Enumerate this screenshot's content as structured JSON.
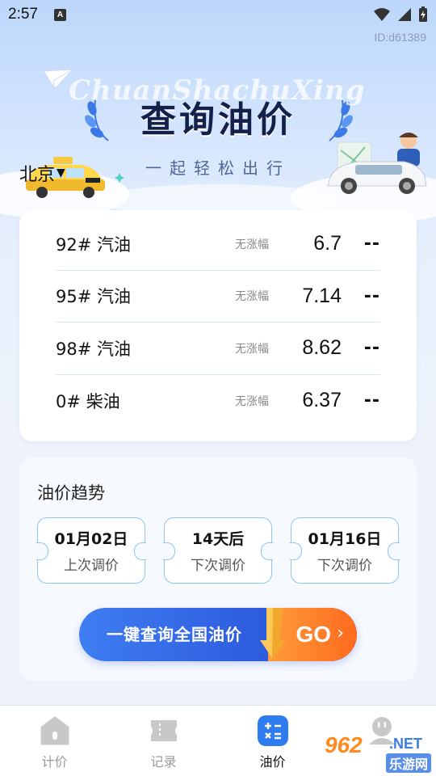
{
  "status_bar": {
    "time": "2:57",
    "notification_letter": "A"
  },
  "header": {
    "device_id": "ID:d61389",
    "script_watermark": "ChuanShachuXing",
    "title": "查询油价",
    "subtitle": "一起轻松出行",
    "city": "北京",
    "city_caret": "▼"
  },
  "prices": {
    "rows": [
      {
        "fuel": "92# 汽油",
        "change": "无涨幅",
        "price": "6.7",
        "trend": "--"
      },
      {
        "fuel": "95# 汽油",
        "change": "无涨幅",
        "price": "7.14",
        "trend": "--"
      },
      {
        "fuel": "98# 汽油",
        "change": "无涨幅",
        "price": "8.62",
        "trend": "--"
      },
      {
        "fuel": "0# 柴油",
        "change": "无涨幅",
        "price": "6.37",
        "trend": "--"
      }
    ]
  },
  "trend": {
    "title": "油价趋势",
    "tickets": [
      {
        "main": "01月02日",
        "sub": "上次调价"
      },
      {
        "main": "14天后",
        "sub": "下次调价"
      },
      {
        "main": "01月16日",
        "sub": "下次调价"
      }
    ],
    "query_button_label": "一键查询全国油价",
    "go_label": "GO",
    "go_chevron": "›"
  },
  "tabs": [
    {
      "label": "计价",
      "icon": "meter-icon",
      "active": false
    },
    {
      "label": "记录",
      "icon": "ticket-icon",
      "active": false
    },
    {
      "label": "油价",
      "icon": "calculator-icon",
      "active": true
    },
    {
      "label": "",
      "icon": "profile-icon",
      "active": false
    }
  ],
  "watermark": {
    "main": "962",
    "net": ".NET",
    "sub": "乐游网"
  },
  "colors": {
    "accent_blue": "#2f6fe6",
    "go_orange": "#ff7a22",
    "ticket_border": "#8ec6ee",
    "divider": "#d8e6f4"
  }
}
